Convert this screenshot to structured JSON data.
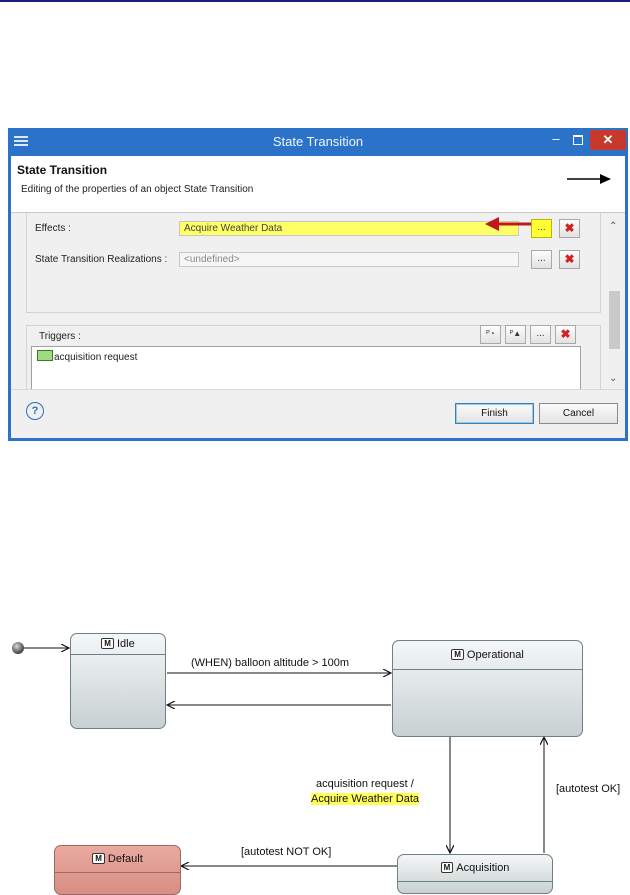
{
  "dialog": {
    "window_title": "State Transition",
    "header_title": "State Transition",
    "header_description": "Editing of the properties of an object State Transition",
    "effects_label": "Effects :",
    "effects_value": "Acquire Weather Data",
    "realizations_label": "State Transition Realizations :",
    "realizations_value": "<undefined>",
    "browse_label": "...",
    "triggers_label": "Triggers :",
    "trigger_item": "acquisition request",
    "finish_label": "Finish",
    "cancel_label": "Cancel",
    "help_label": "?"
  },
  "diagram": {
    "states": {
      "idle": "Idle",
      "operational": "Operational",
      "acquisition": "Acquisition",
      "default": "Default"
    },
    "stereotype": "M",
    "transitions": {
      "idle_to_operational": "(WHEN) balloon altitude > 100m",
      "operational_to_acquisition_trigger": "acquisition request /",
      "operational_to_acquisition_effect": "Acquire Weather Data",
      "acquisition_to_operational": "[autotest OK]",
      "acquisition_to_default": "[autotest NOT OK]"
    }
  },
  "colors": {
    "titlebar": "#2b72c9",
    "highlight": "#ffff55",
    "default_state": "#e09a8f",
    "state_gradient_top": "#f4f7f7",
    "state_gradient_bottom": "#c8d0d1",
    "arrow_red": "#c0161e"
  }
}
